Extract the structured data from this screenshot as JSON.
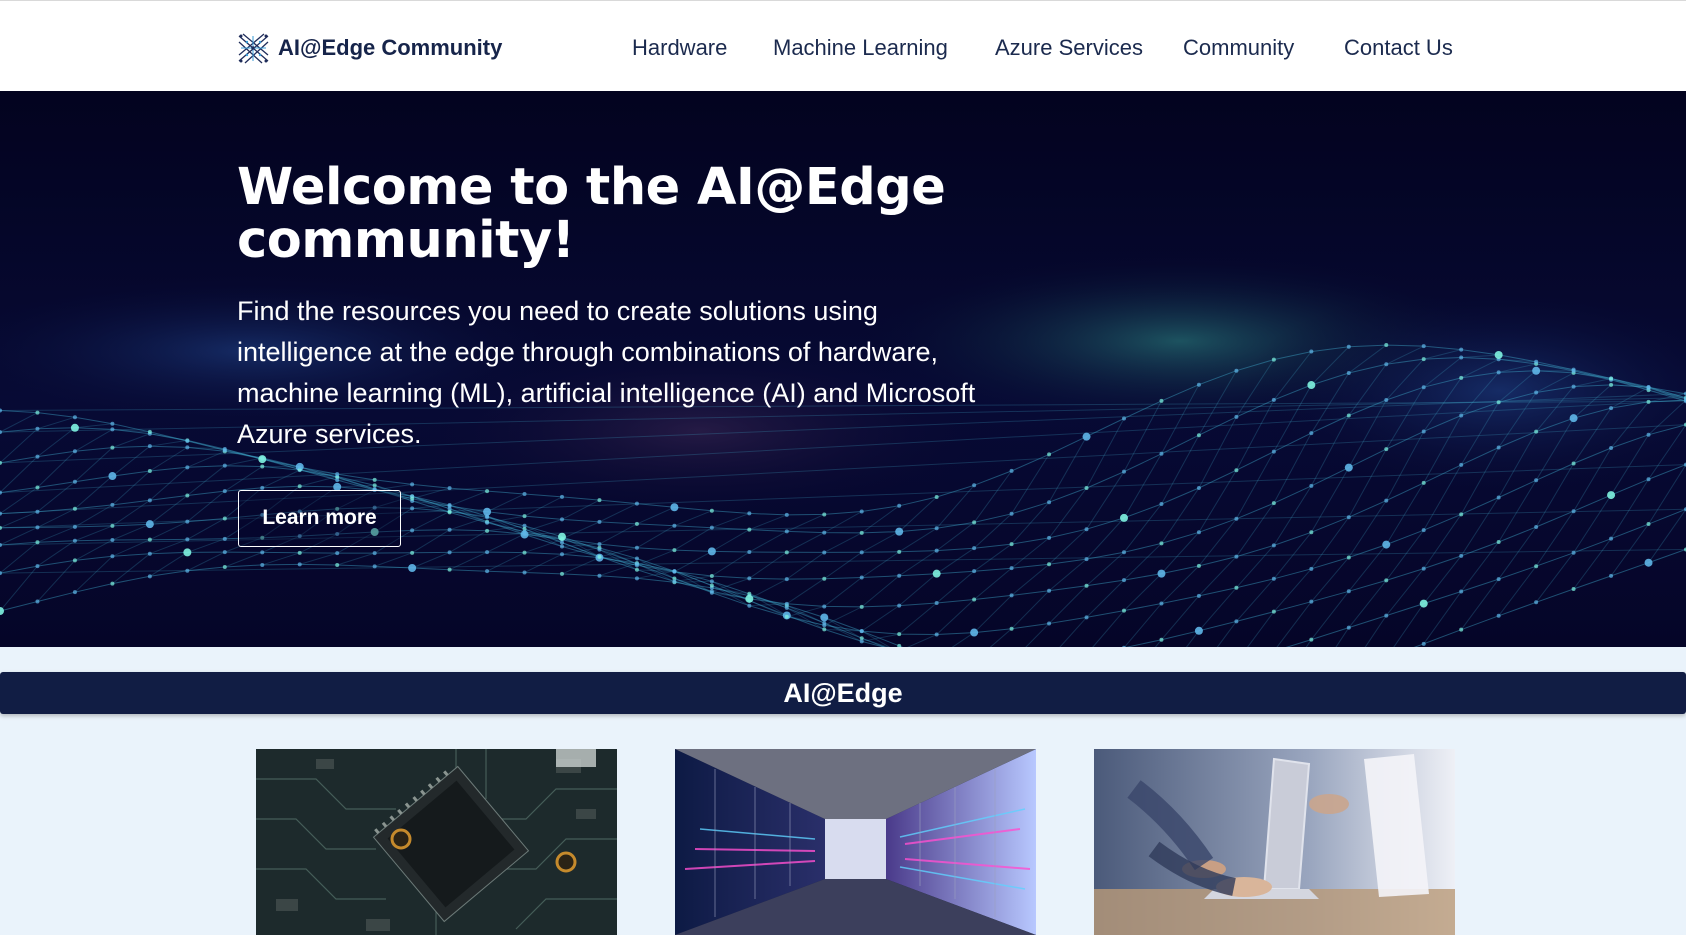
{
  "header": {
    "brand_name": "AI@Edge Community",
    "brand_icon": "network-mesh-logo-icon",
    "nav": [
      {
        "label": "Hardware"
      },
      {
        "label": "Machine Learning"
      },
      {
        "label": "Azure Services"
      },
      {
        "label": "Community"
      },
      {
        "label": "Contact Us"
      }
    ]
  },
  "hero": {
    "title": "Welcome to the AI@Edge community!",
    "description": "Find the resources you need to create solutions using intelligence at the edge through combinations of hardware, machine learning (ML), artificial intelligence (AI) and Microsoft Azure services.",
    "button_label": "Learn more",
    "background": "particle-wave-network-image"
  },
  "section": {
    "title": "AI@Edge"
  },
  "cards": [
    {
      "image": "circuit-board-chip-image"
    },
    {
      "image": "server-room-corridor-image"
    },
    {
      "image": "people-with-laptops-image"
    }
  ],
  "colors": {
    "header_bg": "#ffffff",
    "brand_text": "#16244a",
    "nav_text": "#1b2a4e",
    "hero_bg": "#05052a",
    "hero_accent": "#3fd8c8",
    "section_band": "#111d44",
    "page_bg": "#eaf3fb"
  }
}
